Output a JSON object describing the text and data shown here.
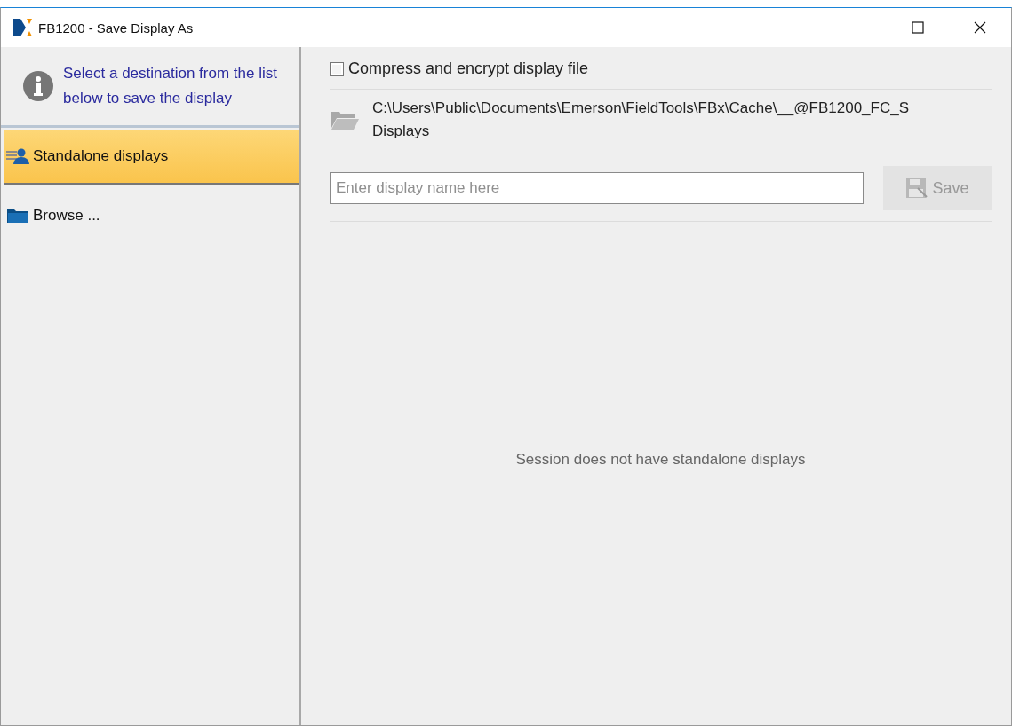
{
  "window": {
    "title": "FB1200 - Save Display As",
    "minimize_disabled": true
  },
  "sidebar": {
    "hint": "Select a destination from the list below to save the display",
    "items": [
      {
        "label": "Standalone displays",
        "kind": "standalone",
        "selected": true
      },
      {
        "label": "Browse ...",
        "kind": "browse",
        "selected": false
      }
    ]
  },
  "options": {
    "compress": {
      "label": "Compress and encrypt display file",
      "checked": false
    }
  },
  "path": {
    "lines": [
      "C:\\Users\\Public\\Documents\\Emerson\\FieldTools\\FBx\\Cache\\__@FB1200_FC_S",
      "Displays"
    ]
  },
  "name_field": {
    "placeholder": "Enter display name here"
  },
  "save_button": {
    "label": "Save",
    "disabled": true
  },
  "empty_message": "Session does not have standalone displays"
}
